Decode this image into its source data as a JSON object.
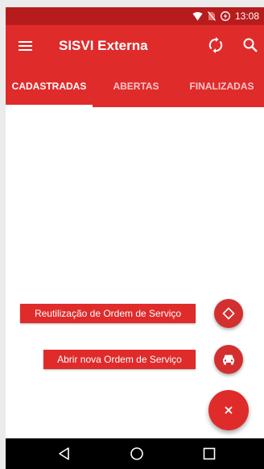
{
  "status_bar": {
    "time": "13:08",
    "icons": [
      "wifi-icon",
      "no-sim-icon",
      "battery-charging-icon"
    ]
  },
  "toolbar": {
    "title": "SISVI Externa",
    "icons": [
      "menu-icon",
      "sync-icon",
      "search-icon"
    ]
  },
  "tabs": [
    {
      "label": "CADASTRADAS",
      "selected": true
    },
    {
      "label": "ABERTAS",
      "selected": false
    },
    {
      "label": "FINALIZADAS",
      "selected": false
    }
  ],
  "fab_menu": {
    "items": [
      {
        "label": "Reutilização de Ordem de Serviço",
        "icon": "diamond-outline-icon"
      },
      {
        "label": "Abrir nova Ordem de Serviço",
        "icon": "car-icon"
      }
    ],
    "main_icon": "close-icon"
  },
  "nav_bar": {
    "icons": [
      "back-icon",
      "home-icon",
      "recents-icon"
    ]
  },
  "colors": {
    "primary": "#e02b2b",
    "primary_dark": "#b71c1c",
    "fab": "#d32f2f",
    "background": "#ffffff"
  }
}
